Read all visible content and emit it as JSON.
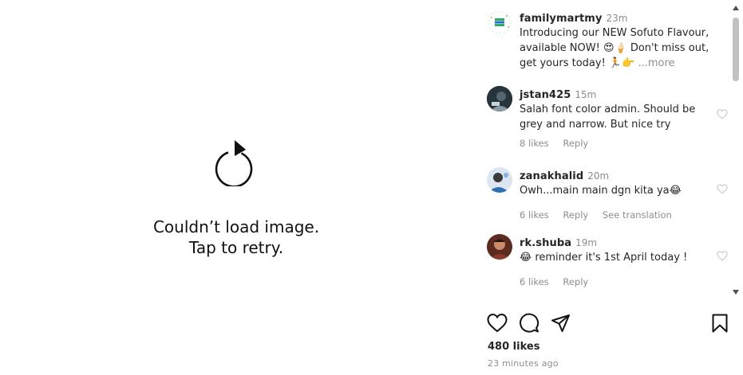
{
  "image_pane": {
    "error_line1": "Couldn’t load image.",
    "error_line2": "Tap to retry."
  },
  "caption": {
    "username": "familymartmy",
    "time": "23m",
    "text": "Introducing our NEW Sofuto Flavour, available NOW! 😍🍦 Don't miss out, get yours today! 🏃👉",
    "more": "...more"
  },
  "comments": [
    {
      "username": "jstan425",
      "time": "15m",
      "text": "Salah font color admin. Should be grey and narrow. But nice try",
      "likes": "8 likes",
      "reply": "Reply"
    },
    {
      "username": "zanakhalid",
      "time": "20m",
      "text": "Owh...main main dgn kita ya😂",
      "likes": "6 likes",
      "reply": "Reply",
      "translation": "See translation"
    },
    {
      "username": "rk.shuba",
      "time": "19m",
      "text": "😂 reminder it's 1st April today !",
      "likes": "6 likes",
      "reply": "Reply"
    }
  ],
  "footer": {
    "likes": "480 likes",
    "ago": "23 minutes ago"
  },
  "colors": {
    "text": "#262626",
    "muted": "#8e8e8e",
    "background": "#ffffff"
  },
  "icons": [
    "retry-icon",
    "heart-icon",
    "comment-icon",
    "share-icon",
    "bookmark-icon"
  ]
}
